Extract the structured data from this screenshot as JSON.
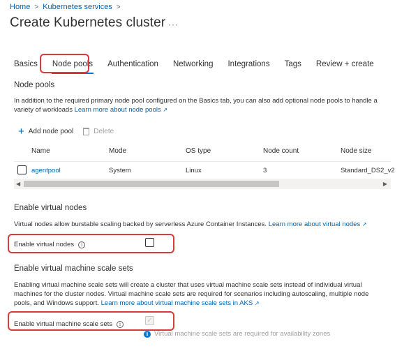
{
  "breadcrumb": {
    "home": "Home",
    "services": "Kubernetes services"
  },
  "page": {
    "title": "Create Kubernetes cluster",
    "more": "···"
  },
  "tabs": [
    "Basics",
    "Node pools",
    "Authentication",
    "Networking",
    "Integrations",
    "Tags",
    "Review + create"
  ],
  "node_pools": {
    "title": "Node pools",
    "description": "In addition to the required primary node pool configured on the Basics tab, you can also add optional node pools to handle a variety of workloads",
    "learn_more": "Learn more about node pools",
    "add_label": "Add node pool",
    "delete_label": "Delete",
    "columns": [
      "Name",
      "Mode",
      "OS type",
      "Node count",
      "Node size"
    ],
    "rows": [
      {
        "name": "agentpool",
        "mode": "System",
        "os": "Linux",
        "count": "3",
        "size": "Standard_DS2_v2"
      }
    ]
  },
  "virtual_nodes": {
    "title": "Enable virtual nodes",
    "description": "Virtual nodes allow burstable scaling backed by serverless Azure Container Instances.",
    "learn_more": "Learn more about virtual nodes",
    "field_label": "Enable virtual nodes",
    "checked": false
  },
  "vmss": {
    "title": "Enable virtual machine scale sets",
    "description": "Enabling virtual machine scale sets will create a cluster that uses virtual machine scale sets instead of individual virtual machines for the cluster nodes. Virtual machine scale sets are required for scenarios including autoscaling, multiple node pools, and Windows support.",
    "learn_more": "Learn more about virtual machine scale sets in AKS",
    "field_label": "Enable virtual machine scale sets",
    "checked": true,
    "note": "Virtual machine scale sets are required for availability zones"
  },
  "colors": {
    "accent": "#0078d4",
    "link": "#0062ad",
    "highlight": "#d93a3a"
  }
}
